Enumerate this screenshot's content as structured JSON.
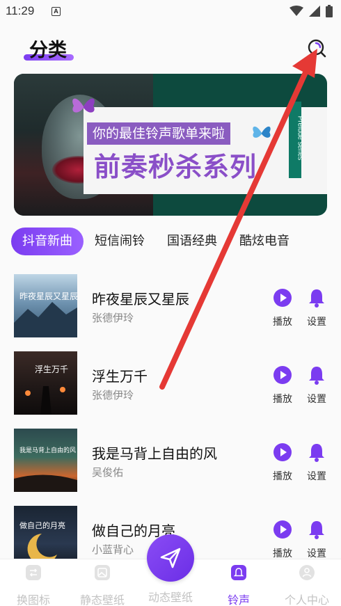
{
  "status_bar": {
    "time": "11:29",
    "notif_letter": "A"
  },
  "header": {
    "title": "分类"
  },
  "banner": {
    "subtitle": "你的最佳铃声歌单来啦",
    "title": "前奏秒杀系列",
    "vertical_text": "Prelude series"
  },
  "tabs": [
    "抖音新曲",
    "短信闹铃",
    "国语经典",
    "酷炫电音"
  ],
  "songs": [
    {
      "title": "昨夜星辰又星辰",
      "artist": "张德伊玲",
      "cover_text": "昨夜星辰又星辰"
    },
    {
      "title": "浮生万千",
      "artist": "张德伊玲",
      "cover_text": "浮生万千"
    },
    {
      "title": "我是马背上自由的风",
      "artist": "吴俊佑",
      "cover_text": "我是马背上自由的风"
    },
    {
      "title": "做自己的月亮",
      "artist": "小蓝背心",
      "cover_text": "做自己的月亮"
    }
  ],
  "actions": {
    "play": "播放",
    "set": "设置"
  },
  "bottom_nav": [
    {
      "label": "换图标",
      "icon": "swap-icon"
    },
    {
      "label": "静态壁纸",
      "icon": "image-icon"
    },
    {
      "label": "动态壁纸",
      "icon": "send-icon"
    },
    {
      "label": "铃声",
      "icon": "bell-icon"
    },
    {
      "label": "个人中心",
      "icon": "user-icon"
    }
  ],
  "colors": {
    "accent": "#7b3cf0",
    "arrow": "#e53935",
    "nav_inactive": "#c3c3c3"
  }
}
